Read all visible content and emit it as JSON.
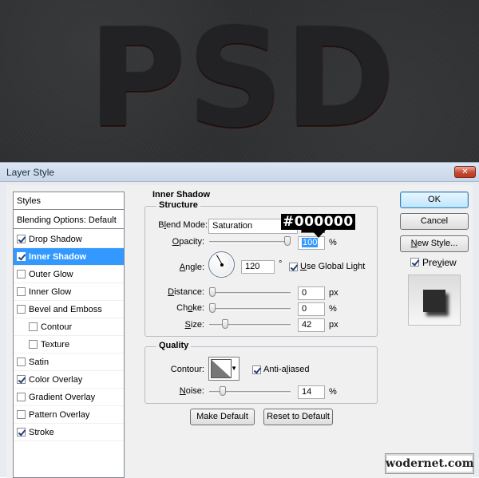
{
  "canvas": {
    "text": "PSD"
  },
  "window": {
    "title": "Layer Style",
    "close_glyph": "✕"
  },
  "styles_panel": {
    "header": "Styles",
    "blending_options": "Blending Options: Default",
    "items": [
      {
        "label": "Drop Shadow",
        "checked": true
      },
      {
        "label": "Inner Shadow",
        "checked": true,
        "selected": true
      },
      {
        "label": "Outer Glow",
        "checked": false
      },
      {
        "label": "Inner Glow",
        "checked": false
      },
      {
        "label": "Bevel and Emboss",
        "checked": false
      },
      {
        "label": "Contour",
        "checked": false,
        "sub": true
      },
      {
        "label": "Texture",
        "checked": false,
        "sub": true
      },
      {
        "label": "Satin",
        "checked": false
      },
      {
        "label": "Color Overlay",
        "checked": true
      },
      {
        "label": "Gradient Overlay",
        "checked": false
      },
      {
        "label": "Pattern Overlay",
        "checked": false
      },
      {
        "label": "Stroke",
        "checked": true
      }
    ]
  },
  "inner_shadow": {
    "title": "Inner Shadow",
    "structure": {
      "legend": "Structure",
      "blend_mode": {
        "label_pre": "B",
        "label_u": "l",
        "label_post": "end Mode:",
        "value": "Saturation",
        "arrow": "▼"
      },
      "color": {
        "hex": "#000000",
        "annotation": "#000000"
      },
      "opacity": {
        "label_u": "O",
        "label_post": "pacity:",
        "value": "100",
        "unit": "%",
        "fraction": 1.0
      },
      "angle": {
        "label_u": "A",
        "label_post": "ngle:",
        "value": "120",
        "unit": "°",
        "degrees": 120
      },
      "use_global_light": {
        "label_u": "U",
        "label_post": "se Global Light",
        "checked": true
      },
      "distance": {
        "label_u": "D",
        "label_post": "istance:",
        "value": "0",
        "unit": "px",
        "fraction": 0.0
      },
      "choke": {
        "label_pre": "Ch",
        "label_u": "o",
        "label_post": "ke:",
        "value": "0",
        "unit": "%",
        "fraction": 0.0
      },
      "size": {
        "label_u": "S",
        "label_post": "ize:",
        "value": "42",
        "unit": "px",
        "fraction": 0.17
      }
    },
    "quality": {
      "legend": "Quality",
      "contour_label": "Contour:",
      "contour_arrow": "▼",
      "anti_aliased": {
        "label_pre": "Anti-a",
        "label_u": "l",
        "label_post": "iased",
        "checked": true
      },
      "noise": {
        "label_u": "N",
        "label_post": "oise:",
        "value": "14",
        "unit": "%",
        "fraction": 0.14
      }
    },
    "make_default": "Make Default",
    "reset_to_default": "Reset to Default"
  },
  "actions": {
    "ok": "OK",
    "cancel": "Cancel",
    "new_style": {
      "label_u": "N",
      "label_post": "ew Style..."
    },
    "preview": {
      "label_pre": "Pre",
      "label_u": "v",
      "label_post": "iew",
      "checked": true
    }
  },
  "watermark": "wodernet.com"
}
